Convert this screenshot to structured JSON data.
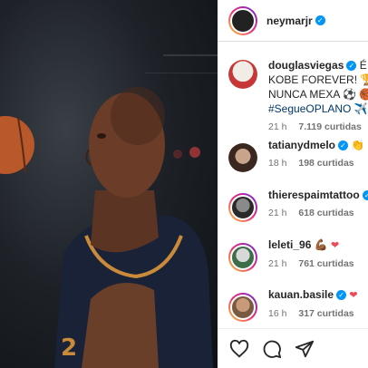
{
  "post": {
    "author": "neymarjr"
  },
  "comments": [
    {
      "user": "douglasviegas",
      "lines": [
        "É di",
        "KOBE FOREVER! 🏆",
        "NUNCA MEXA ⚽ 🏀",
        "#SegueOPLANO ✈️"
      ],
      "time": "21 h",
      "likes": "7.119 curtidas"
    },
    {
      "user": "tatianydmelo",
      "time": "18 h",
      "likes": "198 curtidas"
    },
    {
      "user": "thierespaimtattoo",
      "time": "21 h",
      "likes": "618 curtidas"
    },
    {
      "user": "leleti_96",
      "time": "21 h",
      "likes": "761 curtidas"
    },
    {
      "user": "kauan.basile",
      "time": "16 h",
      "likes": "317 curtidas"
    }
  ],
  "colors": {
    "verified": "#0095f6",
    "hashtag": "#00376b",
    "meta": "#737373"
  }
}
